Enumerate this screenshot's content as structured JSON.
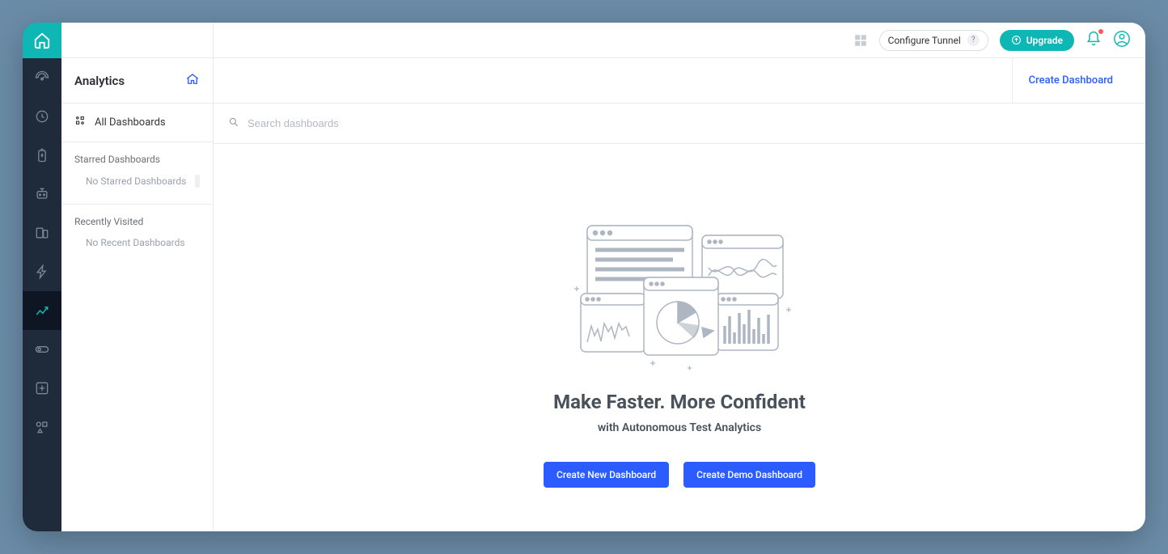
{
  "topbar": {
    "configure_tunnel": "Configure Tunnel",
    "upgrade": "Upgrade"
  },
  "sidepanel": {
    "title": "Analytics",
    "all_dashboards": "All Dashboards",
    "starred_label": "Starred Dashboards",
    "starred_empty": "No Starred Dashboards",
    "recent_label": "Recently Visited",
    "recent_empty": "No Recent Dashboards"
  },
  "subbar": {
    "create_dashboard": "Create Dashboard"
  },
  "search": {
    "placeholder": "Search dashboards"
  },
  "hero": {
    "title": "Make Faster. More Confident",
    "subtitle": "with Autonomous Test Analytics",
    "create_new": "Create New Dashboard",
    "create_demo": "Create Demo Dashboard"
  }
}
